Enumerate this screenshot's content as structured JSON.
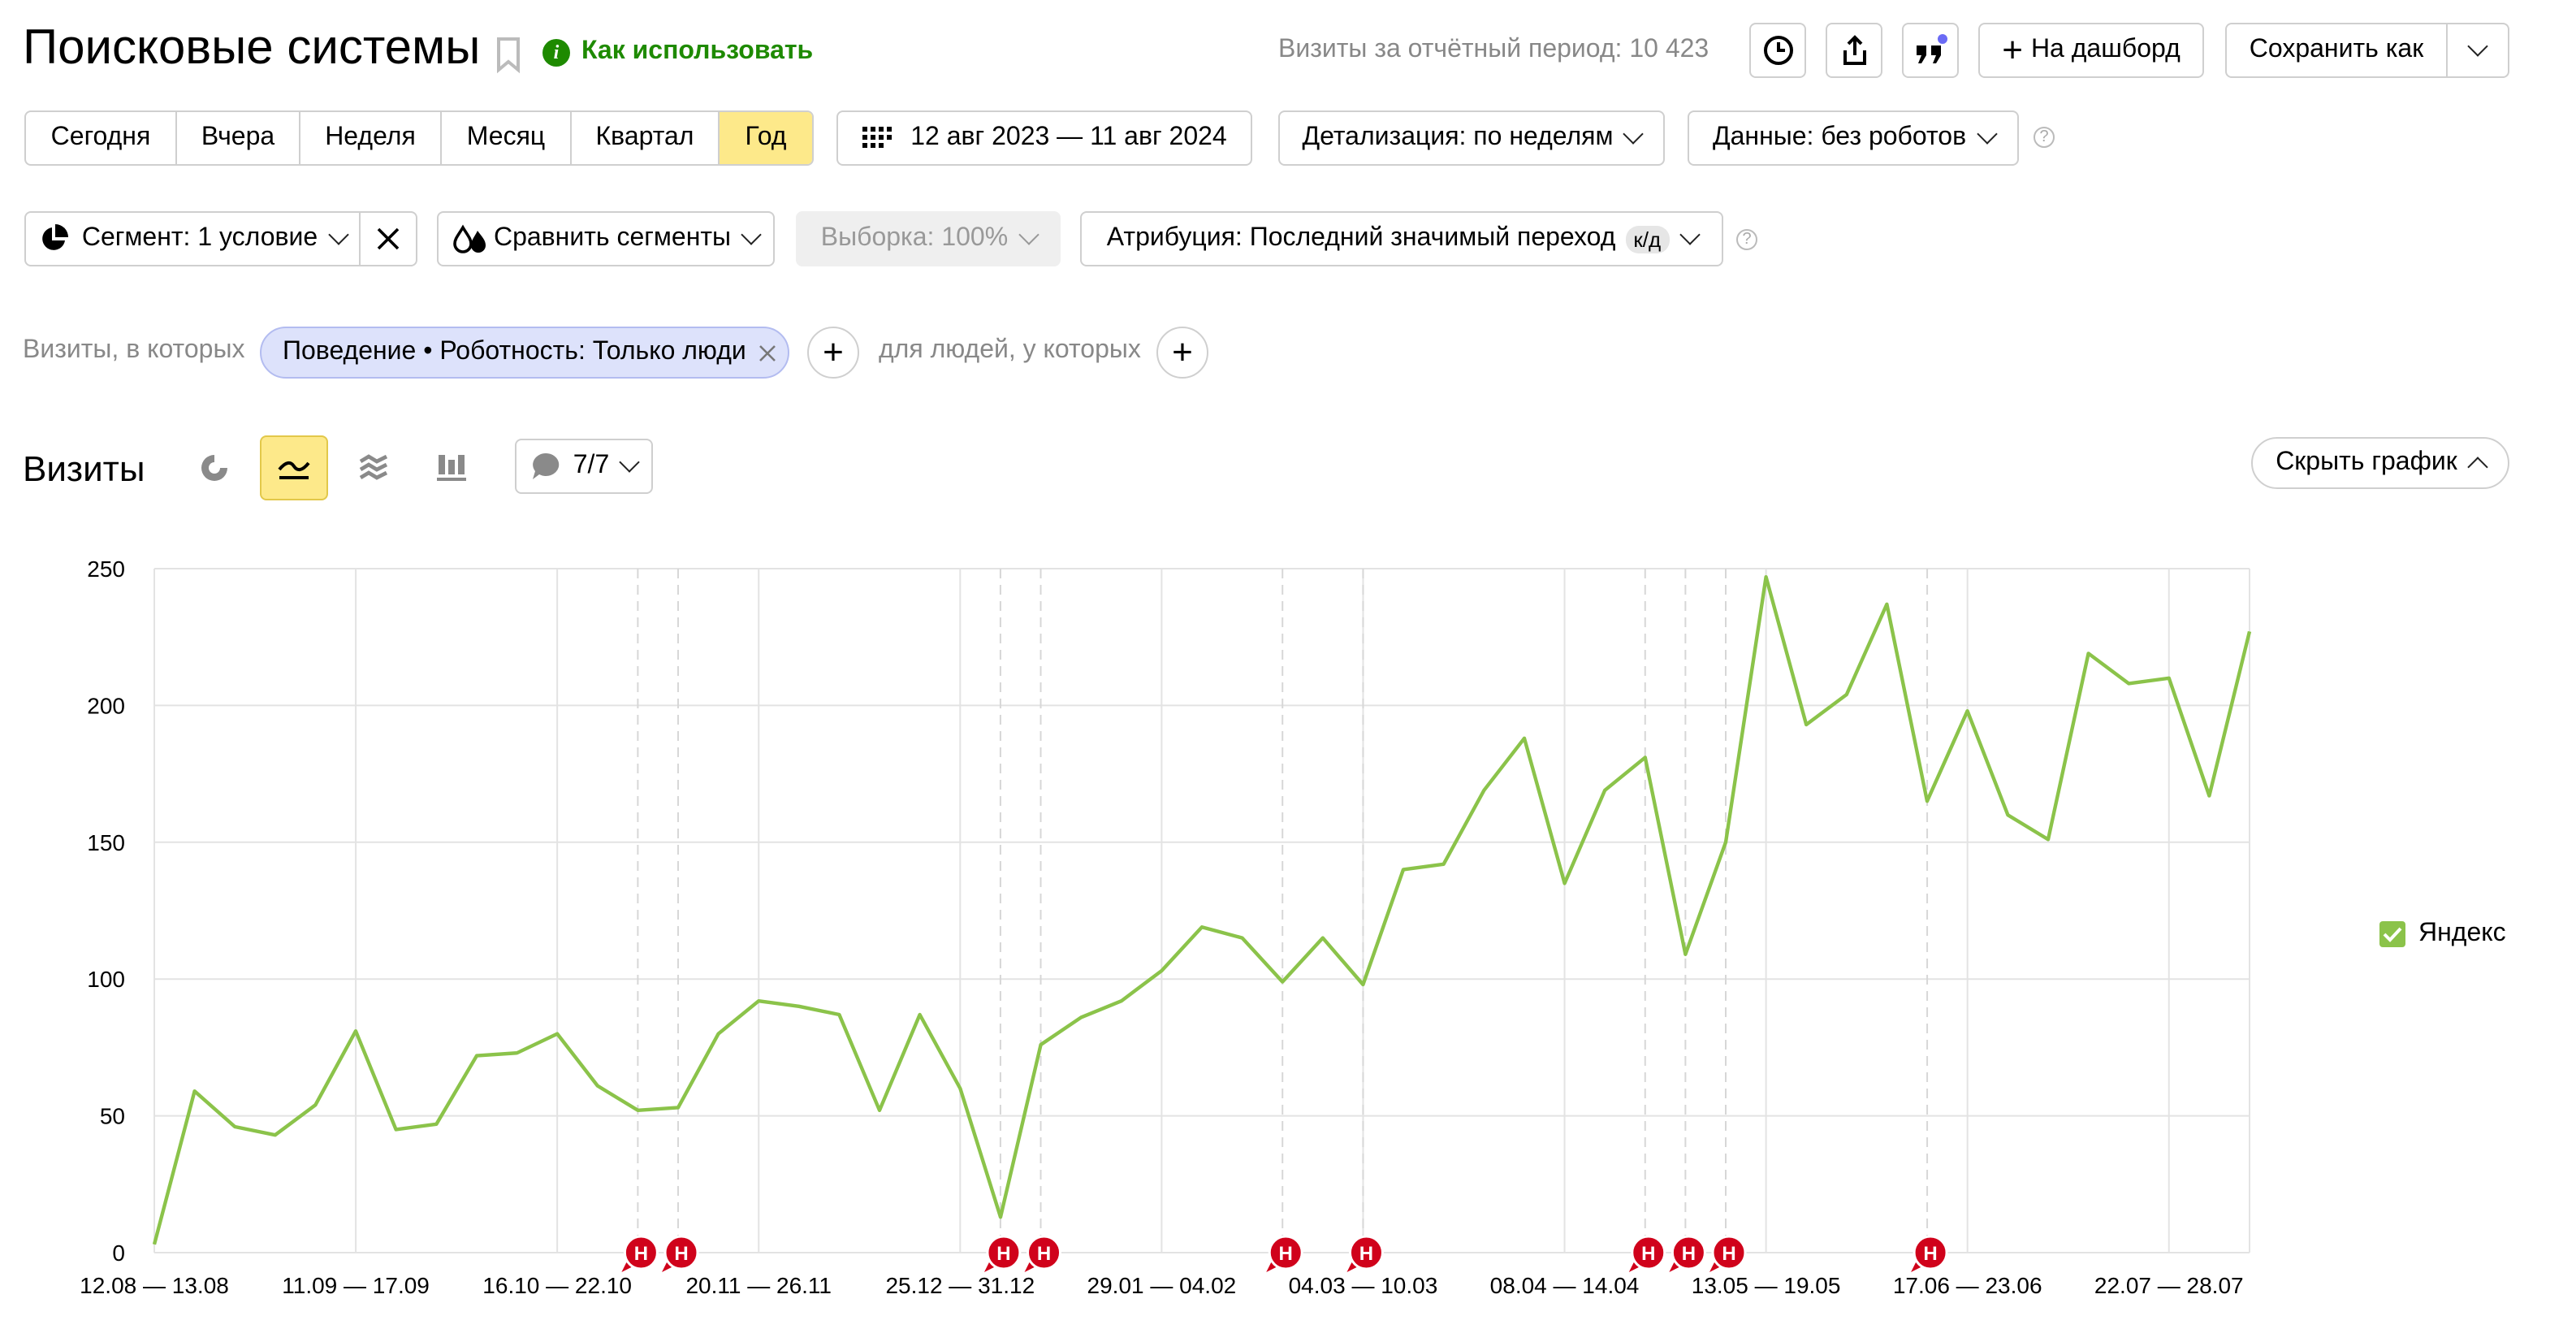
{
  "header": {
    "title": "Поисковые системы",
    "how_to": "Как использовать",
    "visits_label": "Визиты за отчётный период: 10 423",
    "dashboard_label": "На дашборд",
    "save_as_label": "Сохранить как"
  },
  "periods": [
    {
      "label": "Сегодня",
      "active": false
    },
    {
      "label": "Вчера",
      "active": false
    },
    {
      "label": "Неделя",
      "active": false
    },
    {
      "label": "Месяц",
      "active": false
    },
    {
      "label": "Квартал",
      "active": false
    },
    {
      "label": "Год",
      "active": true
    }
  ],
  "toolbar": {
    "date_range": "12 авг 2023 — 11 авг 2024",
    "detail": "Детализация: по неделям",
    "data_filter": "Данные: без роботов",
    "segment": "Сегмент: 1 условие",
    "compare": "Сравнить сегменты",
    "sample": "Выборка: 100%",
    "attribution": "Атрибуция: Последний значимый переход",
    "attribution_badge": "к/д"
  },
  "filters": {
    "visits_where": "Визиты, в которых",
    "chip": "Поведение • Роботность: Только люди",
    "people_where": "для людей, у которых"
  },
  "chart_section": {
    "title": "Визиты",
    "annotations_count": "7/7",
    "hide_chart": "Скрыть график"
  },
  "colors": {
    "line": "#8bc34a",
    "active": "#fde98a",
    "annotation": "#d0021b",
    "green": "#1e8a00"
  },
  "chart_data": {
    "type": "line",
    "series": [
      {
        "name": "Яндекс",
        "values": [
          3,
          59,
          46,
          43,
          54,
          81,
          45,
          47,
          72,
          73,
          80,
          61,
          52,
          53,
          80,
          92,
          90,
          87,
          52,
          87,
          60,
          13,
          76,
          86,
          92,
          103,
          119,
          115,
          99,
          115,
          98,
          140,
          142,
          169,
          188,
          135,
          169,
          181,
          109,
          150,
          247,
          193,
          204,
          237,
          165,
          198,
          160,
          151,
          219,
          208,
          210,
          167,
          227
        ]
      }
    ],
    "x_tick_labels": [
      "12.08 — 13.08",
      "11.09 — 17.09",
      "16.10 — 22.10",
      "20.11 — 26.11",
      "25.12 — 31.12",
      "29.01 — 04.02",
      "04.03 — 10.03",
      "08.04 — 14.04",
      "13.05 — 19.05",
      "17.06 — 23.06",
      "22.07 — 28.07"
    ],
    "x_tick_indices": [
      0,
      5,
      10,
      15,
      20,
      25,
      30,
      35,
      40,
      45,
      50
    ],
    "y_ticks": [
      0,
      50,
      100,
      150,
      200,
      250
    ],
    "ylim": [
      0,
      250
    ],
    "annotation_indices": [
      12,
      13,
      21,
      22,
      28,
      30,
      37,
      38,
      39,
      44
    ],
    "annotation_label": "Н",
    "legend_placement": "right",
    "grid": true
  }
}
